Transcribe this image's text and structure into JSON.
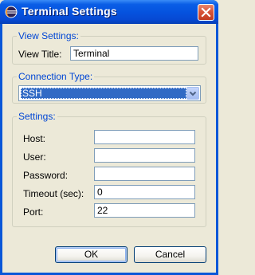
{
  "window": {
    "title": "Terminal Settings"
  },
  "view_settings": {
    "group_label": "View Settings:",
    "view_title_label": "View Title:",
    "view_title_value": "Terminal"
  },
  "connection": {
    "group_label": "Connection Type:",
    "selected": "SSH"
  },
  "settings": {
    "group_label": "Settings:",
    "host_label": "Host:",
    "host_value": "",
    "user_label": "User:",
    "user_value": "",
    "password_label": "Password:",
    "password_value": "",
    "timeout_label": "Timeout (sec):",
    "timeout_value": "0",
    "port_label": "Port:",
    "port_value": "22"
  },
  "buttons": {
    "ok": "OK",
    "cancel": "Cancel"
  },
  "icons": {
    "app": "eclipse-icon",
    "close": "close-icon",
    "dropdown": "chevron-down-icon"
  }
}
